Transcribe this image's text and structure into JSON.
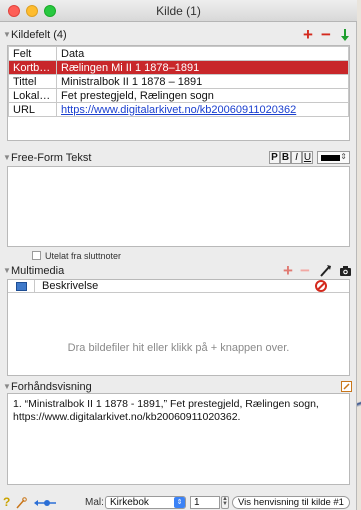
{
  "window": {
    "title": "Kilde (1)"
  },
  "kildefelt": {
    "label": "Kildefelt (4)",
    "columns": [
      "Felt",
      "Data"
    ],
    "rows": [
      {
        "felt": "Kortbes...",
        "data": "Rælingen Mi II 1 1878–1891"
      },
      {
        "felt": "Tittel",
        "data": "Ministralbok II 1 1878 – 1891"
      },
      {
        "felt": "Lokalitet",
        "data": "Fet prestegjeld, Rælingen sogn"
      },
      {
        "felt": "URL",
        "data": "https://www.digitalarkivet.no/kb20060911020362"
      }
    ],
    "selected_row": 0
  },
  "freeform": {
    "label": "Free-Form Tekst",
    "format_buttons": [
      "P",
      "B",
      "I",
      "U"
    ],
    "text_color": "#000000",
    "checkbox_label": "Utelat fra sluttnoter",
    "checkbox_checked": false
  },
  "multimedia": {
    "label": "Multimedia",
    "column_header": "Beskrivelse",
    "empty_hint": "Dra bildefiler hit eller klikk på + knappen over."
  },
  "preview": {
    "label": "Forhåndsvisning",
    "text": "1. “Ministralbok II 1 1878 - 1891,” Fet prestegjeld, Rælingen sogn, https://www.digitalarkivet.no/kb20060911020362."
  },
  "bottom": {
    "help": "?",
    "mal_label": "Mal:",
    "mal_value": "Kirkebok",
    "number": "1",
    "view_button": "Vis henvisning til kilde #1"
  },
  "colors": {
    "accent_red": "#d42a1e",
    "selected_row": "#c8272a",
    "add_green": "#1e9e2e",
    "link_blue": "#1a3fcf"
  }
}
